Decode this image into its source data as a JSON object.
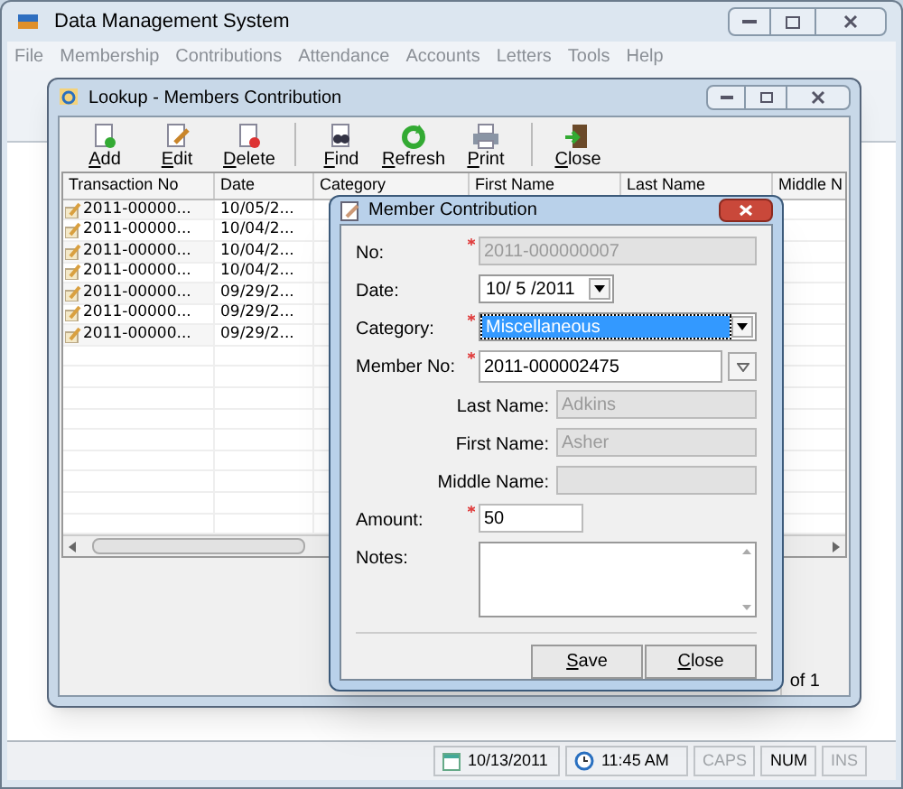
{
  "main_window": {
    "title": "Data Management System",
    "menu": [
      "File",
      "Membership",
      "Contributions",
      "Attendance",
      "Accounts",
      "Letters",
      "Tools",
      "Help"
    ],
    "status_bar": {
      "date": "10/13/2011",
      "time": "11:45 AM",
      "indicators": [
        {
          "label": "CAPS",
          "on": false
        },
        {
          "label": "NUM",
          "on": true
        },
        {
          "label": "INS",
          "on": false
        }
      ]
    }
  },
  "lookup_window": {
    "title": "Lookup - Members Contribution",
    "toolbar": [
      {
        "label": "Add",
        "kind": "add"
      },
      {
        "label": "Edit",
        "kind": "edit"
      },
      {
        "label": "Delete",
        "kind": "delete"
      },
      {
        "label": "Find",
        "kind": "find"
      },
      {
        "label": "Refresh",
        "kind": "refresh"
      },
      {
        "label": "Print",
        "kind": "print"
      },
      {
        "label": "Close",
        "kind": "close"
      }
    ],
    "table": {
      "columns": [
        "Transaction No",
        "Date",
        "Category",
        "First Name",
        "Last Name",
        "Middle N"
      ],
      "rows": [
        {
          "transaction_no": "2011-00000...",
          "date": "10/05/2..."
        },
        {
          "transaction_no": "2011-00000...",
          "date": "10/04/2..."
        },
        {
          "transaction_no": "2011-00000...",
          "date": "10/04/2..."
        },
        {
          "transaction_no": "2011-00000...",
          "date": "10/04/2..."
        },
        {
          "transaction_no": "2011-00000...",
          "date": "09/29/2..."
        },
        {
          "transaction_no": "2011-00000...",
          "date": "09/29/2..."
        },
        {
          "transaction_no": "2011-00000...",
          "date": "09/29/2..."
        }
      ]
    },
    "status": "of 1"
  },
  "dialog": {
    "title": "Member Contribution",
    "fields": [
      {
        "label": "No:",
        "kind": "readonly",
        "required": true,
        "value": "2011-000000007",
        "focused": false
      },
      {
        "label": "Date:",
        "kind": "date",
        "required": false,
        "value": "10/ 5 /2011",
        "focused": false
      },
      {
        "label": "Category:",
        "kind": "select",
        "required": true,
        "value": "Miscellaneous",
        "focused": true
      },
      {
        "label": "Member No:",
        "kind": "combo",
        "required": true,
        "value": "2011-000002475",
        "focused": false
      },
      {
        "label": "Last Name:",
        "kind": "readonly",
        "required": false,
        "value": "Adkins",
        "focused": false
      },
      {
        "label": "First Name:",
        "kind": "readonly",
        "required": false,
        "value": "Asher",
        "focused": false
      },
      {
        "label": "Middle Name:",
        "kind": "readonly",
        "required": false,
        "focused": false
      },
      {
        "label": "Amount:",
        "kind": "text",
        "required": true,
        "value": "50",
        "focused": false
      },
      {
        "label": "Notes:",
        "kind": "textarea",
        "required": false,
        "focused": false
      }
    ],
    "buttons": [
      "Save",
      "Close"
    ]
  }
}
